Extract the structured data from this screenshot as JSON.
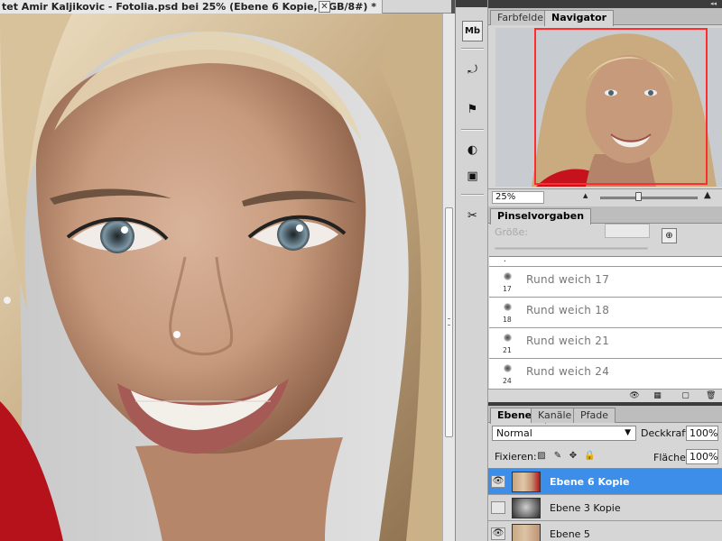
{
  "document": {
    "tab_title": "tet Amir Kaljikovic - Fotolia.psd bei 25% (Ebene 6 Kopie, RGB/8#) *",
    "close_glyph": "✕"
  },
  "panels": {
    "collapse_glyph": "◂◂"
  },
  "toolstrip": {
    "buttons": [
      {
        "name": "mini-bridge-icon",
        "glyph": "Mb"
      },
      {
        "name": "history-icon",
        "glyph": "⤾"
      },
      {
        "name": "actions-icon",
        "glyph": "⚑"
      },
      {
        "name": "adjustments-icon",
        "glyph": "◐"
      },
      {
        "name": "masks-icon",
        "glyph": "▣"
      },
      {
        "name": "tools-icon",
        "glyph": "✂"
      }
    ]
  },
  "top_panel": {
    "tabs": [
      "Farbfelder",
      "Navigator"
    ],
    "active_tab": "Navigator"
  },
  "navigator": {
    "zoom_value": "25%",
    "zoom_level_fraction": 0.36,
    "zoom_out_glyph": "▲",
    "zoom_in_glyph": "▲"
  },
  "brush_presets": {
    "tab_label": "Pinselvorgaben",
    "size_label": "Größe:",
    "new_button_glyph": "⊕",
    "items": [
      {
        "num": "17",
        "name": "Rund weich 17"
      },
      {
        "num": "18",
        "name": "Rund weich 18"
      },
      {
        "num": "21",
        "name": "Rund weich 21"
      },
      {
        "num": "24",
        "name": "Rund weich 24"
      }
    ],
    "footer_icons": [
      "👁",
      "▦",
      "▢",
      "🗑"
    ]
  },
  "layers": {
    "tabs": [
      "Ebenen",
      "Kanäle",
      "Pfade"
    ],
    "active_tab": "Ebenen",
    "blend_mode": "Normal",
    "opacity_label": "Deckkraft:",
    "opacity_value": "100%",
    "lock_label": "Fixieren:",
    "lock_icons": [
      "▨",
      "✎",
      "✥",
      "🔒"
    ],
    "fill_label": "Fläche:",
    "fill_value": "100%",
    "items": [
      {
        "name": "Ebene 6 Kopie",
        "visible": true,
        "selected": true
      },
      {
        "name": "Ebene 3 Kopie",
        "visible": false,
        "selected": false
      },
      {
        "name": "Ebene 5",
        "visible": true,
        "selected": false
      }
    ]
  },
  "colors": {
    "selection_blue": "#3d8ee8",
    "navigator_frame": "#ff2d2d",
    "panel_gray": "#d6d6d6",
    "dark_bar": "#3c3c3c"
  }
}
